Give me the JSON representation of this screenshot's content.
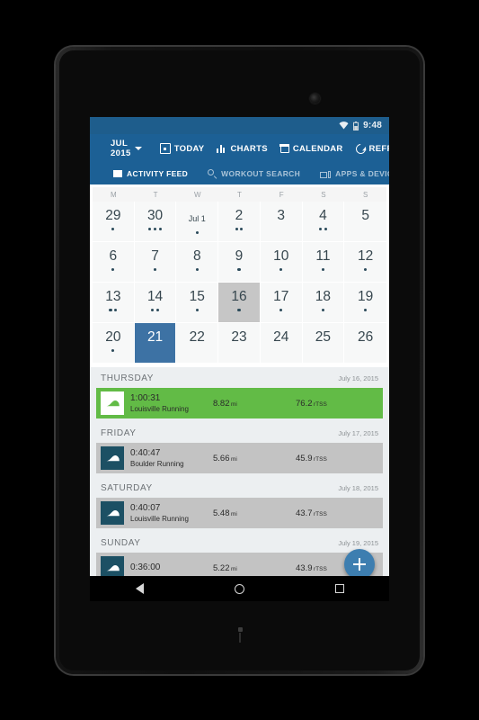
{
  "device": {
    "brand_mark": "nexus-logo",
    "camera": "front-camera"
  },
  "status_bar": {
    "time": "9:48",
    "icons": [
      "wifi-icon",
      "battery-icon"
    ]
  },
  "app_bar": {
    "menu_icon": "hamburger-menu-icon",
    "month_label": "JUL 2015",
    "actions": [
      {
        "label": "TODAY",
        "icon": "today-icon"
      },
      {
        "label": "CHARTS",
        "icon": "charts-icon"
      },
      {
        "label": "CALENDAR",
        "icon": "calendar-icon"
      },
      {
        "label": "REFRESH",
        "icon": "refresh-icon"
      }
    ]
  },
  "tabs": [
    {
      "label": "ACTIVITY FEED",
      "icon": "feed-list-icon",
      "active": true
    },
    {
      "label": "WORKOUT SEARCH",
      "icon": "search-icon",
      "active": false
    },
    {
      "label": "APPS & DEVICES",
      "icon": "devices-icon",
      "active": false
    }
  ],
  "calendar": {
    "day_headers": [
      "M",
      "T",
      "W",
      "T",
      "F",
      "S",
      "S"
    ],
    "weeks": [
      [
        {
          "label": "29",
          "dots": 1,
          "state": "normal"
        },
        {
          "label": "30",
          "dots": 3,
          "state": "normal"
        },
        {
          "label": "Jul 1",
          "dots": 1,
          "state": "month-label"
        },
        {
          "label": "2",
          "dots": 2,
          "state": "normal"
        },
        {
          "label": "3",
          "dots": 0,
          "state": "normal"
        },
        {
          "label": "4",
          "dots": 2,
          "state": "normal"
        },
        {
          "label": "5",
          "dots": 0,
          "state": "normal"
        }
      ],
      [
        {
          "label": "6",
          "dots": 1,
          "state": "normal"
        },
        {
          "label": "7",
          "dots": 1,
          "state": "normal"
        },
        {
          "label": "8",
          "dots": 1,
          "state": "normal"
        },
        {
          "label": "9",
          "dots": 1,
          "state": "normal"
        },
        {
          "label": "10",
          "dots": 1,
          "state": "normal"
        },
        {
          "label": "11",
          "dots": 1,
          "state": "normal"
        },
        {
          "label": "12",
          "dots": 1,
          "state": "normal"
        }
      ],
      [
        {
          "label": "13",
          "dots": 2,
          "state": "normal"
        },
        {
          "label": "14",
          "dots": 2,
          "state": "normal"
        },
        {
          "label": "15",
          "dots": 1,
          "state": "normal"
        },
        {
          "label": "16",
          "dots": 1,
          "state": "today"
        },
        {
          "label": "17",
          "dots": 1,
          "state": "normal"
        },
        {
          "label": "18",
          "dots": 1,
          "state": "normal"
        },
        {
          "label": "19",
          "dots": 1,
          "state": "normal"
        }
      ],
      [
        {
          "label": "20",
          "dots": 1,
          "state": "normal"
        },
        {
          "label": "21",
          "dots": 0,
          "state": "selected"
        },
        {
          "label": "22",
          "dots": 0,
          "state": "normal"
        },
        {
          "label": "23",
          "dots": 0,
          "state": "normal"
        },
        {
          "label": "24",
          "dots": 0,
          "state": "normal"
        },
        {
          "label": "25",
          "dots": 0,
          "state": "normal"
        },
        {
          "label": "26",
          "dots": 0,
          "state": "normal"
        }
      ]
    ]
  },
  "feed": {
    "groups": [
      {
        "dow": "THURSDAY",
        "date": "July 16, 2015",
        "activities": [
          {
            "duration": "1:00:31",
            "name": "Louisville Running",
            "distance_value": "8.82",
            "distance_unit": "mi",
            "tss_value": "76.2",
            "tss_unit": "rTSS",
            "highlight": "green",
            "icon": "running-shoe-icon"
          }
        ]
      },
      {
        "dow": "FRIDAY",
        "date": "July 17, 2015",
        "activities": [
          {
            "duration": "0:40:47",
            "name": "Boulder Running",
            "distance_value": "5.66",
            "distance_unit": "mi",
            "tss_value": "45.9",
            "tss_unit": "rTSS",
            "highlight": "gray",
            "icon": "running-shoe-icon"
          }
        ]
      },
      {
        "dow": "SATURDAY",
        "date": "July 18, 2015",
        "activities": [
          {
            "duration": "0:40:07",
            "name": "Louisville Running",
            "distance_value": "5.48",
            "distance_unit": "mi",
            "tss_value": "43.7",
            "tss_unit": "rTSS",
            "highlight": "gray",
            "icon": "running-shoe-icon"
          }
        ]
      },
      {
        "dow": "SUNDAY",
        "date": "July 19, 2015",
        "activities": [
          {
            "duration": "0:36:00",
            "name": "",
            "distance_value": "5.22",
            "distance_unit": "mi",
            "tss_value": "43.9",
            "tss_unit": "rTSS",
            "highlight": "gray",
            "icon": "running-shoe-icon"
          }
        ]
      }
    ]
  },
  "fab": {
    "label": "+",
    "icon": "add-icon"
  },
  "nav_bar": {
    "back": "back-triangle-icon",
    "home": "home-circle-icon",
    "recents": "recents-square-icon"
  },
  "colors": {
    "app_bar": "#1c6095",
    "status_bar": "#1e5d8c",
    "selected_day": "#3d72a4",
    "today_day": "#c6c6c6",
    "activity_green": "#62bb46",
    "activity_gray": "#c3c3c3",
    "fab": "#3d7eb0",
    "screen_bg": "#eceff1"
  }
}
